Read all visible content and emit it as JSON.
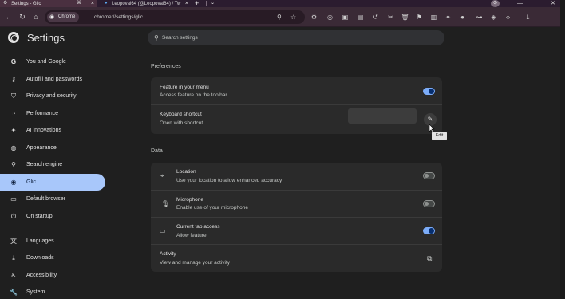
{
  "tabs": [
    {
      "title": "Settings - Glic",
      "active": true
    },
    {
      "title": "Leopoval64 (@Leopoval64) / Tw",
      "active": false
    }
  ],
  "toolbar": {
    "chip_label": "Chrome",
    "url": "chrome://settings/glic"
  },
  "header": {
    "title": "Settings",
    "search_placeholder": "Search settings"
  },
  "sidebar": {
    "items": [
      {
        "label": "You and Google",
        "icon": "google-icon"
      },
      {
        "label": "Autofill and passwords",
        "icon": "key-icon"
      },
      {
        "label": "Privacy and security",
        "icon": "shield-icon"
      },
      {
        "label": "Performance",
        "icon": "speedometer-icon"
      },
      {
        "label": "AI innovations",
        "icon": "sparkle-icon"
      },
      {
        "label": "Appearance",
        "icon": "palette-icon"
      },
      {
        "label": "Search engine",
        "icon": "search-icon"
      },
      {
        "label": "Glic",
        "icon": "chrome-icon",
        "active": true
      },
      {
        "label": "Default browser",
        "icon": "browser-icon"
      },
      {
        "label": "On startup",
        "icon": "power-icon"
      },
      {
        "label": "Languages",
        "icon": "translate-icon"
      },
      {
        "label": "Downloads",
        "icon": "download-icon"
      },
      {
        "label": "Accessibility",
        "icon": "accessibility-icon"
      },
      {
        "label": "System",
        "icon": "wrench-icon"
      }
    ]
  },
  "preferences": {
    "section_title": "Preferences",
    "feature_menu": {
      "title": "Feature in your menu",
      "subtitle": "Access feature on the toolbar",
      "enabled": true
    },
    "keyboard_shortcut": {
      "title": "Keyboard shortcut",
      "subtitle": "Open with shortcut",
      "edit_tooltip": "Edit"
    }
  },
  "data_section": {
    "section_title": "Data",
    "location": {
      "title": "Location",
      "subtitle": "Use your location to allow enhanced accuracy",
      "enabled": false
    },
    "microphone": {
      "title": "Microphone",
      "subtitle": "Enable use of your microphone",
      "enabled": false
    },
    "current_tab": {
      "title": "Current tab access",
      "subtitle": "Allow feature",
      "enabled": true
    },
    "activity": {
      "title": "Activity",
      "subtitle": "View and manage your activity"
    }
  },
  "colors": {
    "accent": "#a8c7fa",
    "toggle_on": "#7cacf8",
    "background": "#1f1f1f",
    "card": "#2a2a2a"
  }
}
